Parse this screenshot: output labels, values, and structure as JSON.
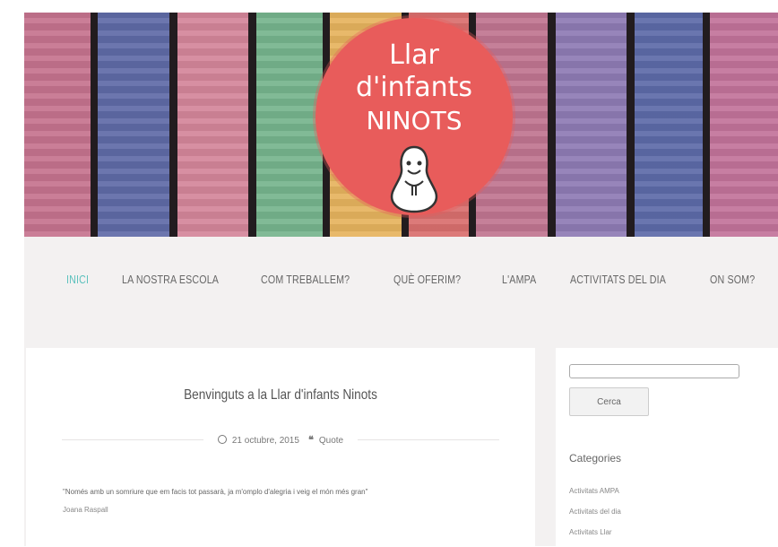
{
  "header": {
    "logo": {
      "line1": "Llar",
      "line2": "d'infants",
      "line3": "NINOTS"
    }
  },
  "nav": {
    "items": [
      {
        "label": "INICI",
        "active": true
      },
      {
        "label": "LA NOSTRA ESCOLA",
        "active": false
      },
      {
        "label": "COM TREBALLEM?",
        "active": false
      },
      {
        "label": "QUÈ OFERIM?",
        "active": false
      },
      {
        "label": "L'AMPA",
        "active": false
      },
      {
        "label": "ACTIVITATS DEL DIA",
        "active": false
      },
      {
        "label": "ON SOM?",
        "active": false
      }
    ]
  },
  "post": {
    "title": "Benvinguts a la Llar d'infants Ninots",
    "date": "21 octubre, 2015",
    "format": "Quote",
    "quote": "\"Només amb un somriure que em facis tot passarà, ja m'omplo d'alegria i veig el món més gran\"",
    "author": "Joana Raspall"
  },
  "sidebar": {
    "search": {
      "placeholder": "",
      "value": "",
      "button_label": "Cerca"
    },
    "categories_title": "Categories",
    "categories": [
      "Activitats AMPA",
      "Activitats del dia",
      "Activitats Llar"
    ]
  },
  "colors": {
    "accent": "#5bc1bd",
    "logo_circle": "#e85c5b",
    "background": "#f3f1f1",
    "planks": [
      "#c5738e",
      "#5f6aa7",
      "#d4869a",
      "#76b48d",
      "#e6b35e",
      "#d96f6e",
      "#c07590",
      "#8e7bb4",
      "#5d6aa8",
      "#c2739a"
    ]
  }
}
